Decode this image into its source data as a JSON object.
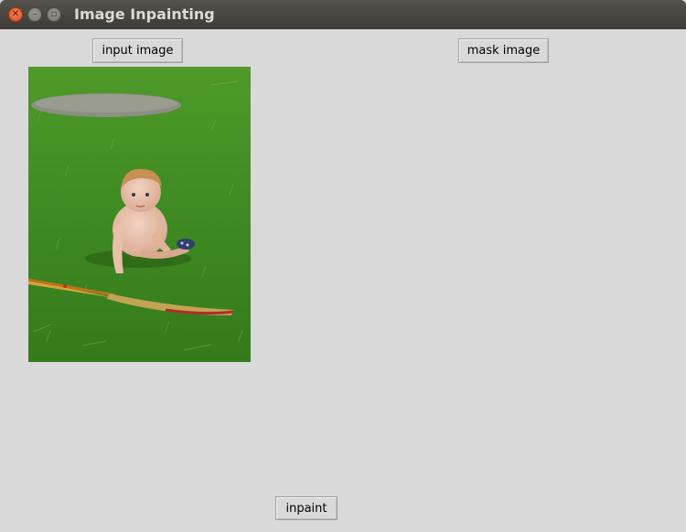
{
  "window": {
    "title": "Image Inpainting",
    "controls": [
      "close-icon",
      "minimize-icon",
      "maximize-icon"
    ]
  },
  "buttons": {
    "input_image": "input image",
    "mask_image": "mask image",
    "inpaint": "inpaint"
  },
  "colors": {
    "background": "#d9d9d9",
    "titlebar": "#3c3b37",
    "close_button": "#e0491d",
    "grass": "#3f8a22"
  }
}
